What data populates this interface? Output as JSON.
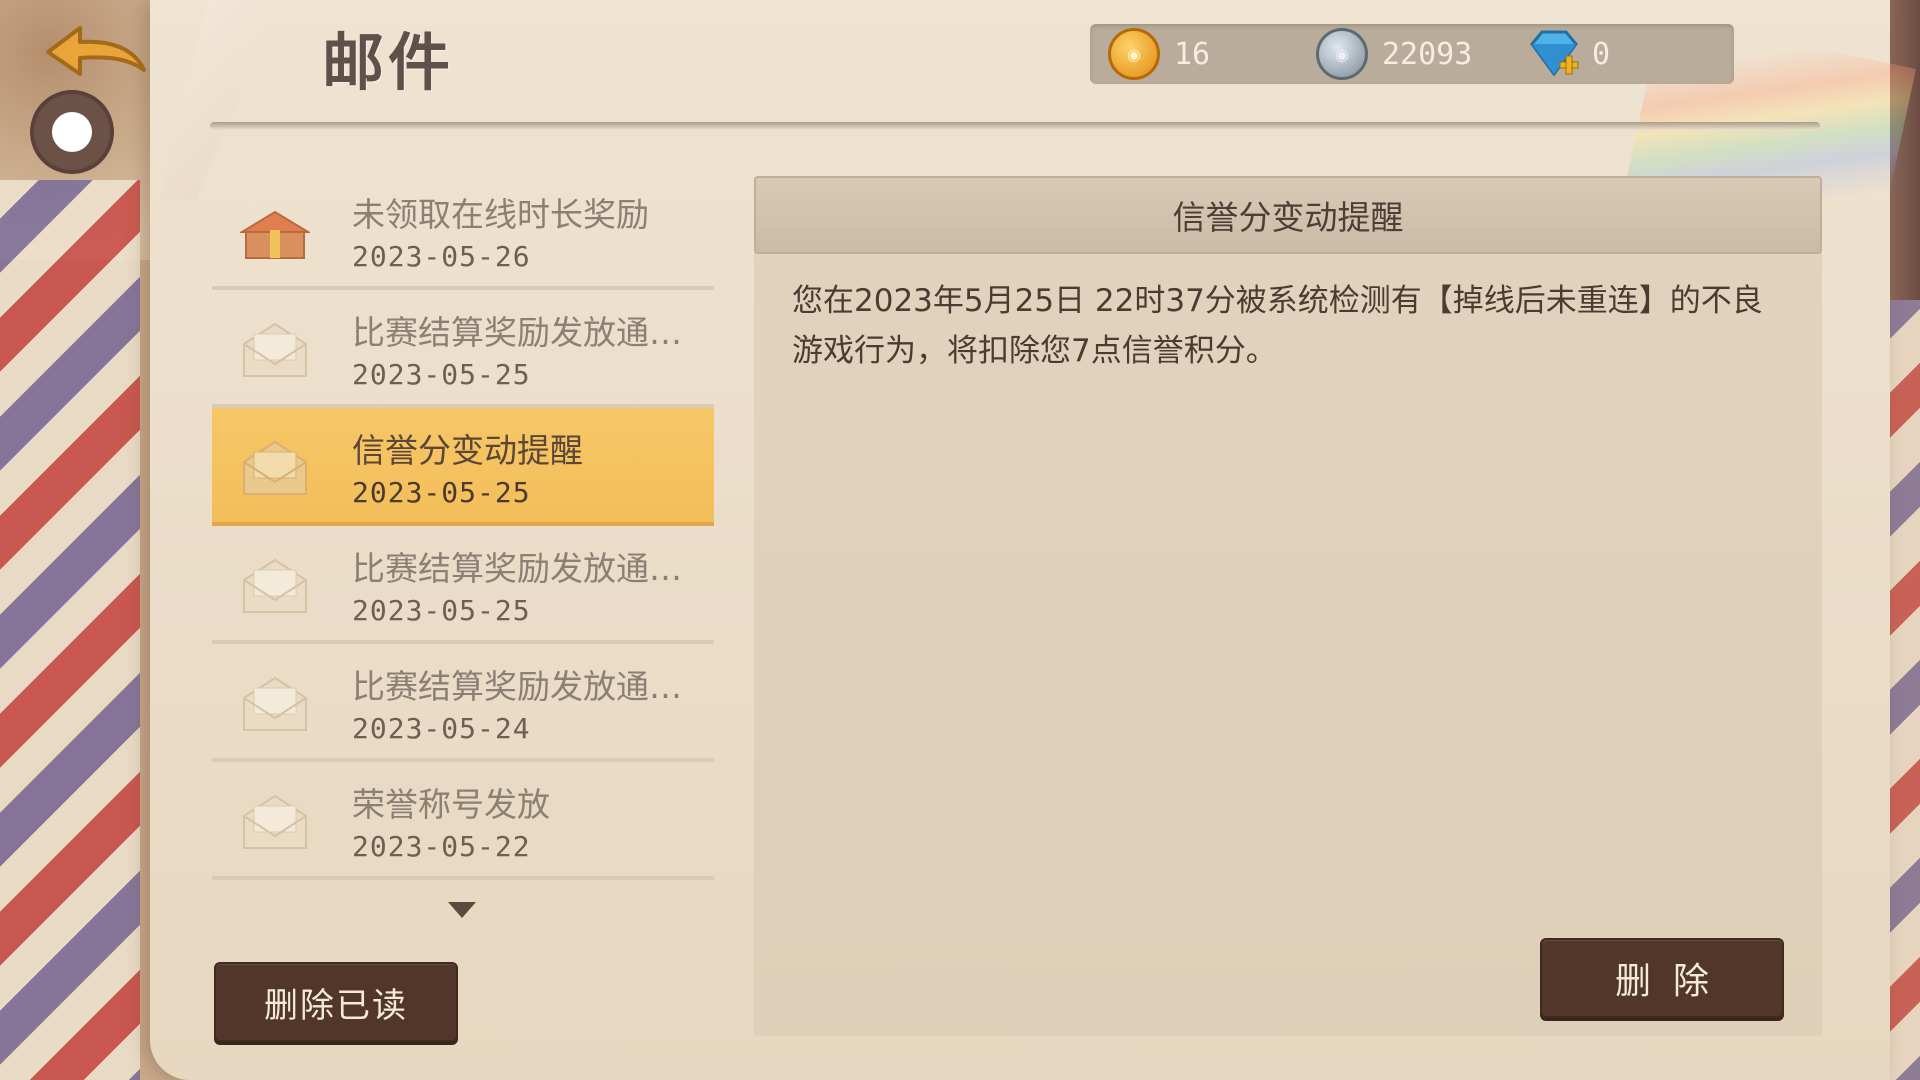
{
  "header": {
    "title": "邮件"
  },
  "currencies": [
    {
      "icon": "gold-coin-icon",
      "value": "16"
    },
    {
      "icon": "silver-coin-icon",
      "value": "22093"
    },
    {
      "icon": "diamond-add-icon",
      "value": "0"
    }
  ],
  "mail_list": [
    {
      "title": "未领取在线时长奖励",
      "date": "2023-05-26",
      "icon": "gift-box-icon",
      "selected": false
    },
    {
      "title": "比赛结算奖励发放通…",
      "date": "2023-05-25",
      "icon": "envelope-open-icon",
      "selected": false
    },
    {
      "title": "信誉分变动提醒",
      "date": "2023-05-25",
      "icon": "envelope-open-icon",
      "selected": true
    },
    {
      "title": "比赛结算奖励发放通…",
      "date": "2023-05-25",
      "icon": "envelope-open-icon",
      "selected": false
    },
    {
      "title": "比赛结算奖励发放通…",
      "date": "2023-05-24",
      "icon": "envelope-open-icon",
      "selected": false
    },
    {
      "title": "荣誉称号发放",
      "date": "2023-05-22",
      "icon": "envelope-open-icon",
      "selected": false
    }
  ],
  "buttons": {
    "delete_read": "删除已读",
    "delete": "删除"
  },
  "detail": {
    "title": "信誉分变动提醒",
    "body": "您在2023年5月25日 22时37分被系统检测有【掉线后未重连】的不良游戏行为，将扣除您7点信誉积分。"
  },
  "colors": {
    "selected_row": "#f2be5a",
    "button_dark": "#52362a",
    "parchment": "#eadcc7"
  }
}
